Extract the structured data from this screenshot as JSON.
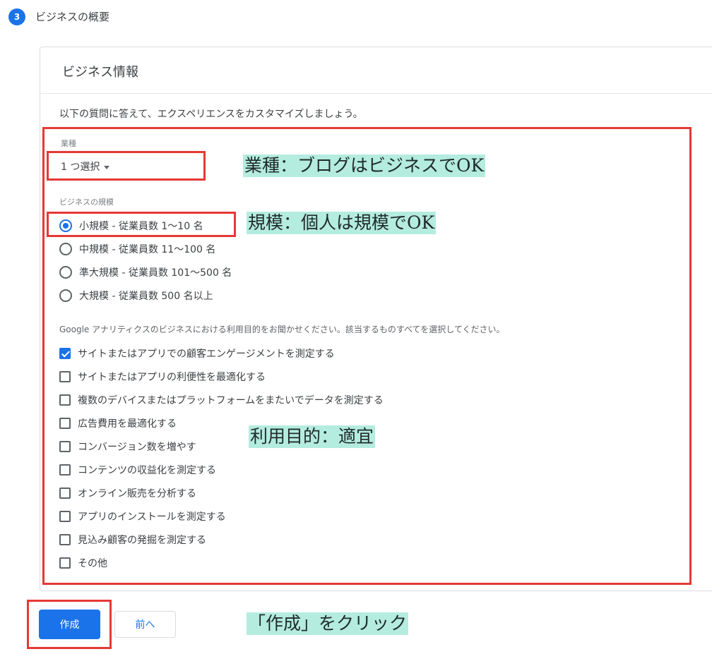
{
  "step": {
    "number": "3",
    "title": "ビジネスの概要"
  },
  "card": {
    "title": "ビジネス情報",
    "description": "以下の質問に答えて、エクスペリエンスをカスタマイズしましょう。"
  },
  "industry": {
    "label": "業種",
    "select_value": "1 つ選択"
  },
  "business_size": {
    "label": "ビジネスの規模",
    "options": [
      {
        "label": "小規模 - 従業員数 1〜10 名",
        "selected": true
      },
      {
        "label": "中規模 - 従業員数 11〜100 名",
        "selected": false
      },
      {
        "label": "準大規模 - 従業員数 101〜500 名",
        "selected": false
      },
      {
        "label": "大規模 - 従業員数 500 名以上",
        "selected": false
      }
    ]
  },
  "purpose": {
    "label": "Google アナリティクスのビジネスにおける利用目的をお聞かせください。該当するものすべてを選択してください。",
    "options": [
      {
        "label": "サイトまたはアプリでの顧客エンゲージメントを測定する",
        "checked": true
      },
      {
        "label": "サイトまたはアプリの利便性を最適化する",
        "checked": false
      },
      {
        "label": "複数のデバイスまたはプラットフォームをまたいでデータを測定する",
        "checked": false
      },
      {
        "label": "広告費用を最適化する",
        "checked": false
      },
      {
        "label": "コンバージョン数を増やす",
        "checked": false
      },
      {
        "label": "コンテンツの収益化を測定する",
        "checked": false
      },
      {
        "label": "オンライン販売を分析する",
        "checked": false
      },
      {
        "label": "アプリのインストールを測定する",
        "checked": false
      },
      {
        "label": "見込み顧客の発掘を測定する",
        "checked": false
      },
      {
        "label": "その他",
        "checked": false
      }
    ]
  },
  "buttons": {
    "create": "作成",
    "back": "前へ"
  },
  "annotations": {
    "industry_note": "業種：ブログはビジネスでOK",
    "size_note": "規模：個人は規模でOK",
    "purpose_note": "利用目的：適宜",
    "create_note": "「作成」をクリック"
  },
  "colors": {
    "accent": "#1a73e8",
    "highlight_border": "#e53935",
    "annotation_bg": "#b4ecdf"
  }
}
